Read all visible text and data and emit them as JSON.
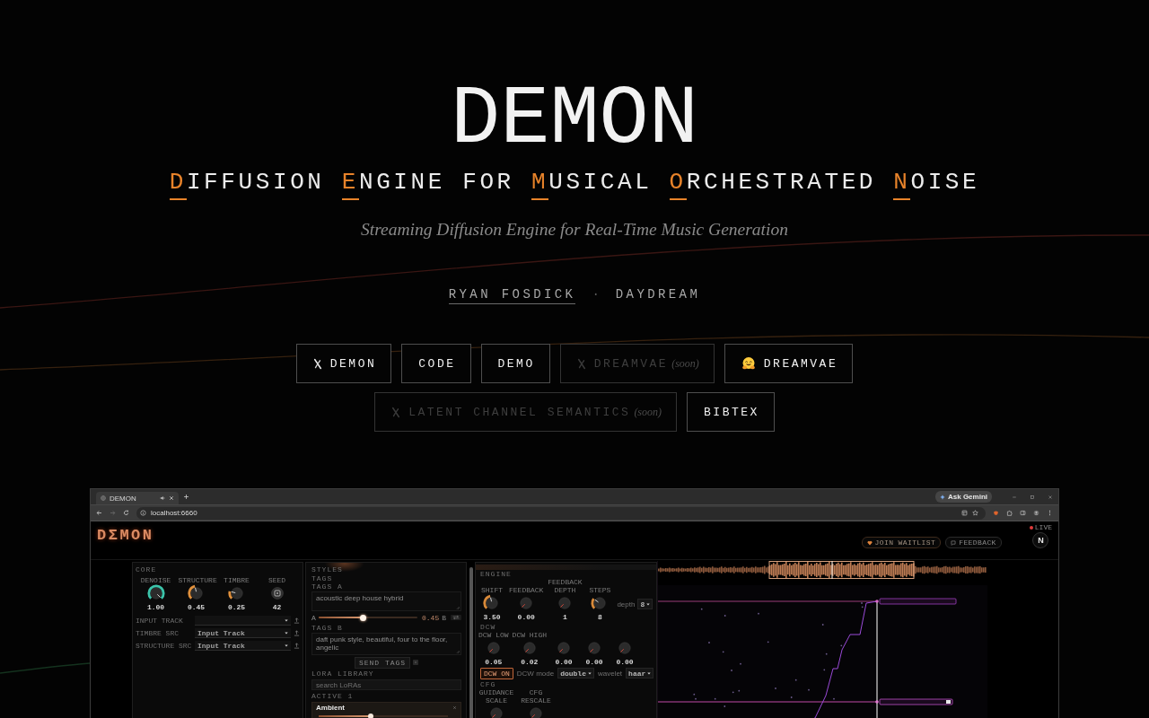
{
  "hero": {
    "title": "DEMON",
    "acronym": [
      {
        "word": "DIFFUSION",
        "accent": true
      },
      {
        "word": "ENGINE",
        "accent": true
      },
      {
        "word": "FOR",
        "accent": false
      },
      {
        "word": "MUSICAL",
        "accent": true
      },
      {
        "word": "ORCHESTRATED",
        "accent": true
      },
      {
        "word": "NOISE",
        "accent": true
      }
    ],
    "tagline": "Streaming Diffusion Engine for Real-Time Music Generation"
  },
  "authors": [
    {
      "name": "RYAN FOSDICK",
      "linked": true
    },
    {
      "name": "DAYDREAM",
      "linked": false
    }
  ],
  "author_separator": "·",
  "link_rows": [
    [
      {
        "kind": "paper",
        "label": "DEMON",
        "disabled": false
      },
      {
        "kind": "code",
        "label": "CODE",
        "disabled": false
      },
      {
        "kind": "demo",
        "label": "DEMO",
        "disabled": false
      },
      {
        "kind": "paper",
        "label": "DREAMVAE",
        "note": "(soon)",
        "disabled": true
      },
      {
        "kind": "model",
        "label": "DREAMVAE",
        "disabled": false
      }
    ],
    [
      {
        "kind": "paper",
        "label": "LATENT CHANNEL SEMANTICS",
        "note": "(soon)",
        "disabled": true
      },
      {
        "kind": "citation",
        "label": "BIBTEX",
        "disabled": false
      }
    ]
  ],
  "screenshot": {
    "browser": {
      "tab_title": "DEMON",
      "ask_button": "Ask Gemini",
      "address": "localhost:6660"
    },
    "app": {
      "logo": "DΣMON",
      "header_buttons": [
        {
          "label": "JOIN WAITLIST"
        },
        {
          "label": "FEEDBACK"
        }
      ],
      "live_label": "LIVE",
      "avatar_letter": "N",
      "core": {
        "title": "CORE",
        "knobs": [
          {
            "kind": "knob",
            "label": "DENOISE",
            "value": "1.00",
            "level": 1,
            "color": "#3cc4aa"
          },
          {
            "kind": "knob",
            "label": "STRUCTURE",
            "value": "0.45",
            "level": 0.45,
            "color": "#e0903c"
          },
          {
            "kind": "knob",
            "label": "TIMBRE",
            "value": "0.25",
            "level": 0.22,
            "color": "#e0903c"
          },
          {
            "kind": "dice",
            "label": "SEED",
            "value": "42"
          }
        ],
        "rows": [
          {
            "label": "INPUT TRACK"
          },
          {
            "label": "TIMBRE SRC",
            "value": "Input Track"
          },
          {
            "label": "STRUCTURE SRC",
            "value": "Input Track"
          }
        ]
      },
      "styles": {
        "title": "STYLES",
        "tags_label": "TAGS",
        "tags_a_label": "TAGS A",
        "tags_a": "acoustic deep house hybrid",
        "blend": {
          "left_label": "A",
          "level": 0.45,
          "reading": "0.45",
          "right_label": "B"
        },
        "tags_b_label": "TAGS B",
        "tags_b": "daft punk style, beautiful, four to the floor, angelic",
        "send_button": "SEND TAGS",
        "library_label": "LORA LIBRARY",
        "search_placeholder": "search LoRAs",
        "active_label": "ACTIVE 1",
        "active_loras": [
          {
            "name": "Ambient",
            "level": 0.4
          }
        ]
      },
      "engine": {
        "title": "ENGINE",
        "knobs": [
          {
            "label": "SHIFT",
            "value": "3.50",
            "level": 0.45
          },
          {
            "label": "FEEDBACK",
            "value": "0.00"
          },
          {
            "label": "FEEDBACK DEPTH",
            "value": "1"
          },
          {
            "label": "STEPS",
            "value": "8",
            "level": 0.3
          }
        ],
        "depth_label": "depth",
        "depth_value": "8",
        "dcw_title": "DCW",
        "dcw_knobs": [
          {
            "label": "DCW LOW",
            "value": "0.05"
          },
          {
            "label": "DCW HIGH",
            "value": "0.02"
          },
          {
            "value": "0.00"
          },
          {
            "value": "0.00"
          },
          {
            "value": "0.00"
          }
        ],
        "dcw_button": "DCW ON",
        "dcw_on": true,
        "mode_label": "DCW mode",
        "mode_value": "double",
        "wavelet_label": "wavelet",
        "wavelet_value": "haar",
        "cfg_title": "CFG",
        "cfg_knobs": [
          {
            "label": "GUIDANCE SCALE"
          },
          {
            "label": "CFG RESCALE"
          }
        ]
      }
    }
  }
}
